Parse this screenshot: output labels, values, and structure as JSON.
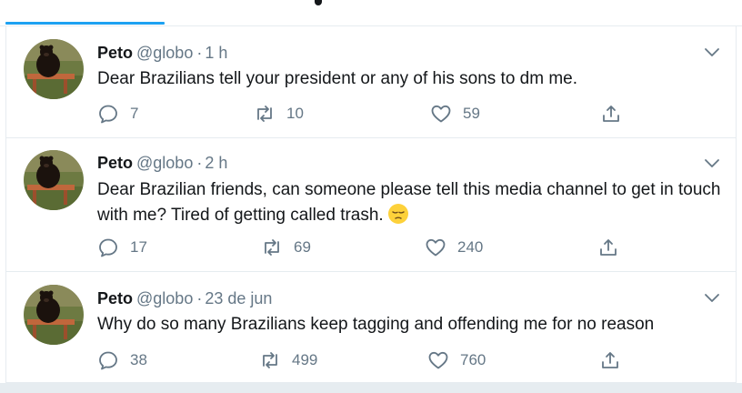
{
  "colors": {
    "accent": "#1da1f2",
    "text_primary": "#14171a",
    "text_secondary": "#657786",
    "border": "#e6ecf0"
  },
  "tweets": [
    {
      "display_name": "Peto",
      "handle": "@globo",
      "separator": "·",
      "timestamp": "1 h",
      "text": "Dear Brazilians tell your president or any of his sons to dm me.",
      "emoji": "",
      "replies": "7",
      "retweets": "10",
      "likes": "59"
    },
    {
      "display_name": "Peto",
      "handle": "@globo",
      "separator": "·",
      "timestamp": "2 h",
      "text": "Dear Brazilian friends, can someone please tell this media channel to get in touch with me? Tired of getting called trash.",
      "emoji": "pensive-face-emoji",
      "replies": "17",
      "retweets": "69",
      "likes": "240"
    },
    {
      "display_name": "Peto",
      "handle": "@globo",
      "separator": "·",
      "timestamp": "23 de jun",
      "text": "Why do so many Brazilians keep tagging and offending me for no reason",
      "emoji": "",
      "replies": "38",
      "retweets": "499",
      "likes": "760"
    }
  ],
  "icons": {
    "reply": "reply-icon",
    "retweet": "retweet-icon",
    "like": "heart-icon",
    "share": "share-icon",
    "more": "chevron-down-icon"
  }
}
